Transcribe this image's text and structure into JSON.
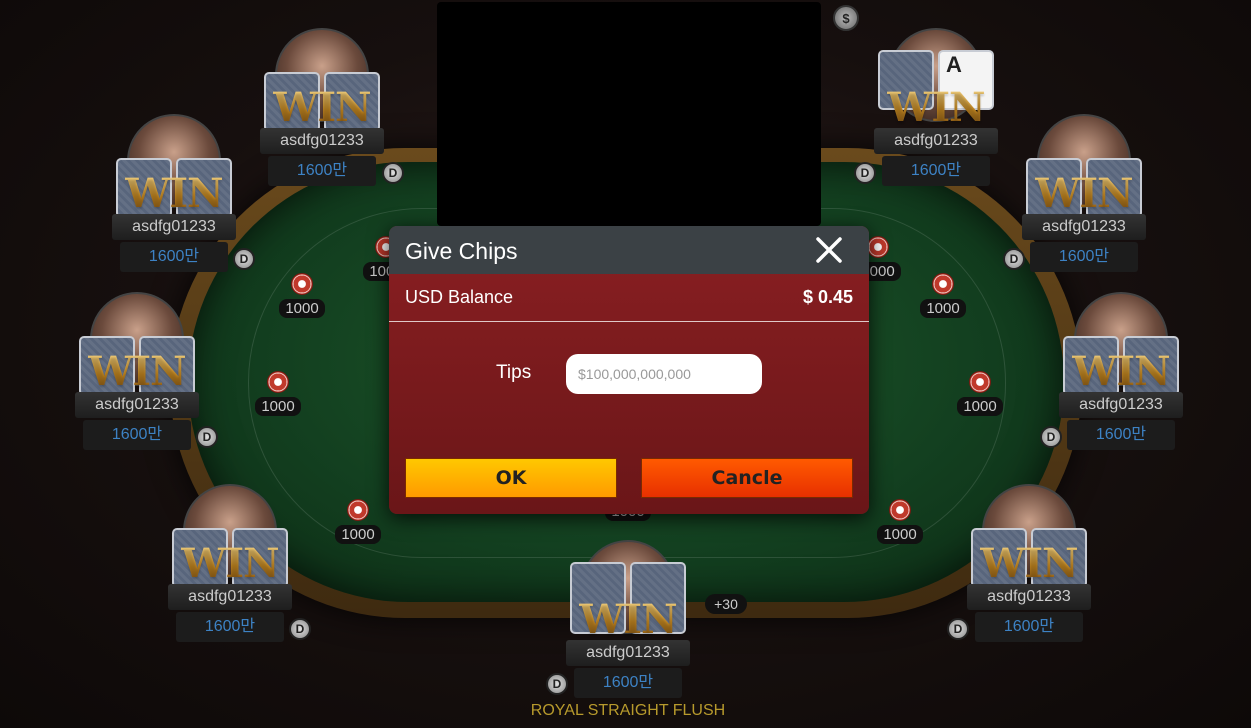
{
  "table": {
    "pot_amount": "1000",
    "hand_name": "ROYAL STRAIGHT FLUSH",
    "gain_badge": "+30",
    "top_coin_icon": "$",
    "felt_color": "#134020",
    "rim_color": "#6a4a1c"
  },
  "seats": [
    {
      "name": "asdfg01233",
      "chips": "1600만",
      "win": "WIN",
      "dealer": "D"
    },
    {
      "name": "asdfg01233",
      "chips": "1600만",
      "win": "WIN",
      "dealer": "D",
      "face_card": "A"
    },
    {
      "name": "asdfg01233",
      "chips": "1600만",
      "win": "WIN",
      "dealer": "D"
    },
    {
      "name": "asdfg01233",
      "chips": "1600만",
      "win": "WIN",
      "dealer": "D"
    },
    {
      "name": "asdfg01233",
      "chips": "1600만",
      "win": "WIN",
      "dealer": "D"
    },
    {
      "name": "asdfg01233",
      "chips": "1600만",
      "win": "WIN",
      "dealer": "D"
    },
    {
      "name": "asdfg01233",
      "chips": "1600만",
      "win": "WIN",
      "dealer": "D"
    },
    {
      "name": "asdfg01233",
      "chips": "1600만",
      "win": "WIN",
      "dealer": "D"
    },
    {
      "name": "asdfg01233",
      "chips": "1600만",
      "win": "WIN",
      "dealer": "D"
    }
  ],
  "bets": [
    "1000",
    "1000",
    "1000",
    "1000",
    "1000",
    "1000",
    "1000",
    "1000",
    "1000",
    "1000"
  ],
  "dialog": {
    "title": "Give Chips",
    "close_icon": "close-icon",
    "balance_label": "USD Balance",
    "balance_value": "$ 0.45",
    "tips_label": "Tips",
    "tips_placeholder": "$100,000,000,000",
    "tips_value": "",
    "ok_label": "OK",
    "cancel_label": "Cancle",
    "colors": {
      "header": "#3b4145",
      "body": "#8a1f22",
      "ok": "#ffb400",
      "cancel": "#ff4a00"
    }
  }
}
